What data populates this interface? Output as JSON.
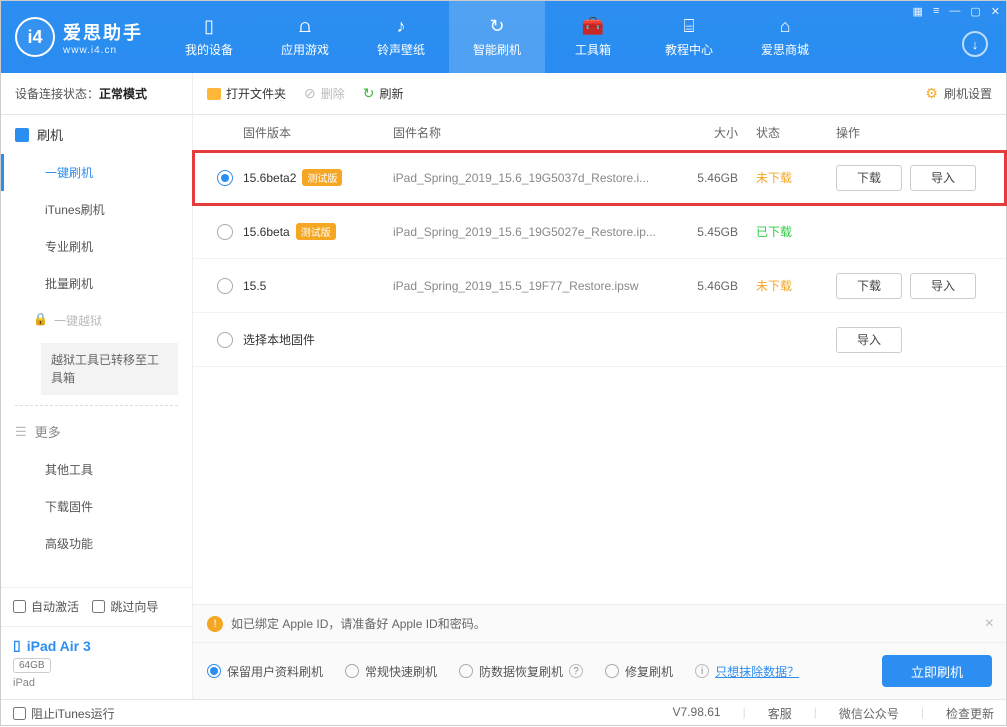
{
  "app": {
    "title": "爱思助手",
    "subtitle": "www.i4.cn"
  },
  "winctrl": {
    "grid": "▦",
    "list": "≡",
    "min": "—",
    "max": "▢",
    "close": "✕"
  },
  "nav": [
    {
      "label": "我的设备",
      "icon": "▯"
    },
    {
      "label": "应用游戏",
      "icon": "⩍"
    },
    {
      "label": "铃声壁纸",
      "icon": "♪"
    },
    {
      "label": "智能刷机",
      "icon": "↻"
    },
    {
      "label": "工具箱",
      "icon": "🧰"
    },
    {
      "label": "教程中心",
      "icon": "⌸"
    },
    {
      "label": "爱思商城",
      "icon": "⌂"
    }
  ],
  "status": {
    "label": "设备连接状态：",
    "value": "正常模式"
  },
  "toolbar": {
    "open": "打开文件夹",
    "delete": "删除",
    "refresh": "刷新",
    "settings": "刷机设置"
  },
  "sidebar": {
    "flash_head": "刷机",
    "items": {
      "oneclick": "一键刷机",
      "itunes": "iTunes刷机",
      "pro": "专业刷机",
      "batch": "批量刷机"
    },
    "jailbreak": "一键越狱",
    "jb_note": "越狱工具已转移至工具箱",
    "more": "更多",
    "more_items": {
      "other": "其他工具",
      "download": "下载固件",
      "advanced": "高级功能"
    },
    "auto_activate": "自动激活",
    "skip_guide": "跳过向导"
  },
  "device": {
    "name": "iPad Air 3",
    "storage": "64GB",
    "type": "iPad"
  },
  "table": {
    "head": {
      "version": "固件版本",
      "name": "固件名称",
      "size": "大小",
      "status": "状态",
      "ops": "操作"
    },
    "rows": [
      {
        "selected": true,
        "version": "15.6beta2",
        "beta": true,
        "name": "iPad_Spring_2019_15.6_19G5037d_Restore.i...",
        "size": "5.46GB",
        "status": "未下载",
        "status_cls": "orange",
        "ops": [
          "下载",
          "导入"
        ],
        "highlight": true
      },
      {
        "selected": false,
        "version": "15.6beta",
        "beta": true,
        "name": "iPad_Spring_2019_15.6_19G5027e_Restore.ip...",
        "size": "5.45GB",
        "status": "已下载",
        "status_cls": "green",
        "ops": []
      },
      {
        "selected": false,
        "version": "15.5",
        "beta": false,
        "name": "iPad_Spring_2019_15.5_19F77_Restore.ipsw",
        "size": "5.46GB",
        "status": "未下载",
        "status_cls": "orange",
        "ops": [
          "下载",
          "导入"
        ]
      },
      {
        "selected": false,
        "version": "选择本地固件",
        "beta": false,
        "name": "",
        "size": "",
        "status": "",
        "status_cls": "",
        "ops": [
          "导入"
        ]
      }
    ],
    "beta_tag": "测试版"
  },
  "alert": {
    "text": "如已绑定 Apple ID，请准备好 Apple ID和密码。"
  },
  "options": {
    "keep": "保留用户资料刷机",
    "normal": "常规快速刷机",
    "anti": "防数据恢复刷机",
    "repair": "修复刷机",
    "erase_link": "只想抹除数据？",
    "go": "立即刷机"
  },
  "footer": {
    "block_itunes": "阻止iTunes运行",
    "version": "V7.98.61",
    "service": "客服",
    "wechat": "微信公众号",
    "update": "检查更新"
  }
}
